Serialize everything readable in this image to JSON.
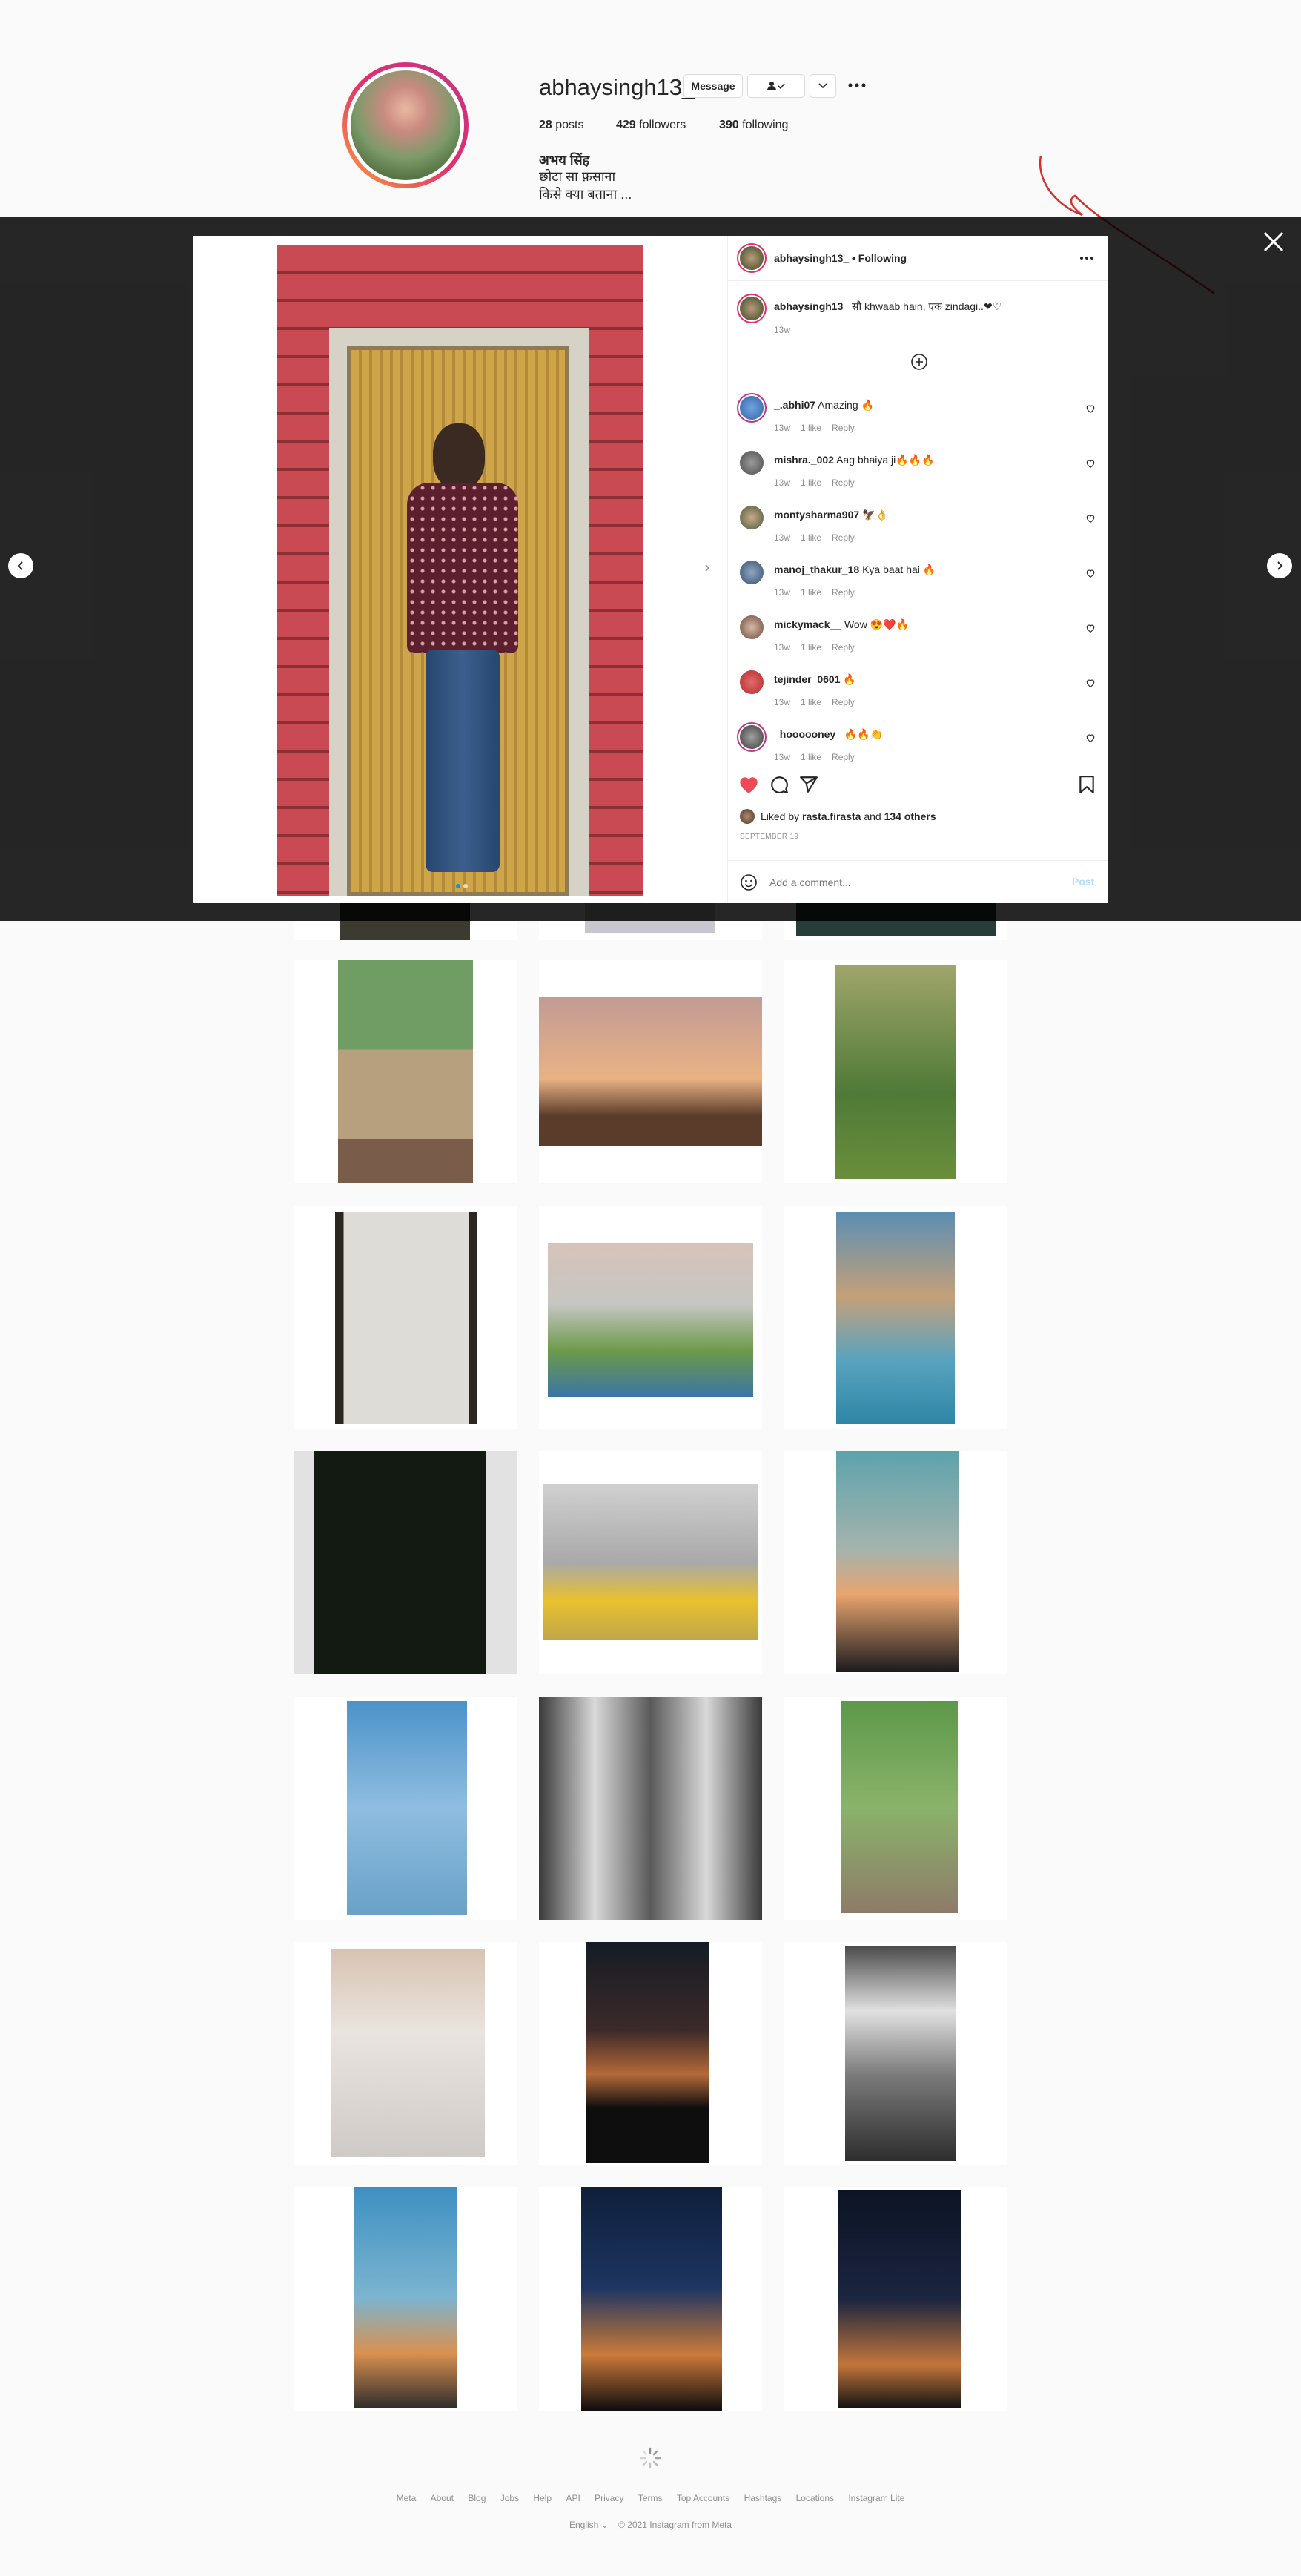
{
  "profile": {
    "username": "abhaysingh13_",
    "message_label": "Message",
    "posts_count": "28",
    "posts_label": "posts",
    "followers_count": "429",
    "followers_label": "followers",
    "following_count": "390",
    "following_label": "following",
    "full_name": "अभय सिंह",
    "bio_line1": "छोटा सा फ़साना",
    "bio_line2": "किसे क्या बताना ..."
  },
  "post": {
    "header_username": "abhaysingh13_",
    "header_following": "• Following",
    "caption_username": "abhaysingh13_",
    "caption_text": "सौ khwaab hain, एक zindagi..❤♡",
    "caption_time": "13w",
    "liked_by_prefix": "Liked by",
    "liked_by_user": "rasta.firasta",
    "liked_by_suffix": "and",
    "liked_by_others": "134 others",
    "date": "SEPTEMBER 19",
    "add_comment_placeholder": "Add a comment...",
    "post_button": "Post",
    "comments": [
      {
        "user": "_.abhi07",
        "text": "Amazing 🔥",
        "time": "13w",
        "likes": "1 like",
        "reply": "Reply"
      },
      {
        "user": "mishra._002",
        "text": "Aag bhaiya ji🔥🔥🔥",
        "time": "13w",
        "likes": "1 like",
        "reply": "Reply"
      },
      {
        "user": "montysharma907",
        "text": "🦅👌",
        "time": "13w",
        "likes": "1 like",
        "reply": "Reply"
      },
      {
        "user": "manoj_thakur_18",
        "text": "Kya baat hai 🔥",
        "time": "13w",
        "likes": "1 like",
        "reply": "Reply"
      },
      {
        "user": "mickymack__",
        "text": "Wow 😍❤️🔥",
        "time": "13w",
        "likes": "1 like",
        "reply": "Reply"
      },
      {
        "user": "tejinder_0601",
        "text": "🔥",
        "time": "13w",
        "likes": "1 like",
        "reply": "Reply"
      },
      {
        "user": "_hoooooney_",
        "text": "🔥🔥👏",
        "time": "13w",
        "likes": "1 like",
        "reply": "Reply"
      }
    ]
  },
  "footer": {
    "links": [
      "Meta",
      "About",
      "Blog",
      "Jobs",
      "Help",
      "API",
      "Privacy",
      "Terms",
      "Top Accounts",
      "Hashtags",
      "Locations",
      "Instagram Lite"
    ],
    "language": "English",
    "copyright": "© 2021 Instagram from Meta"
  },
  "colors": {
    "like_red": "#ed4956",
    "annotation_red": "#d62f2f",
    "overlay": "#262626",
    "post_button_disabled": "#b3dbff"
  },
  "icons": [
    "close-icon",
    "chevron-left-icon",
    "chevron-right-icon",
    "more-icon",
    "heart-icon",
    "comment-icon",
    "share-icon",
    "bookmark-icon",
    "emoji-icon",
    "add-circle-icon",
    "user-check-icon",
    "chevron-down-icon",
    "loading-spinner-icon"
  ]
}
